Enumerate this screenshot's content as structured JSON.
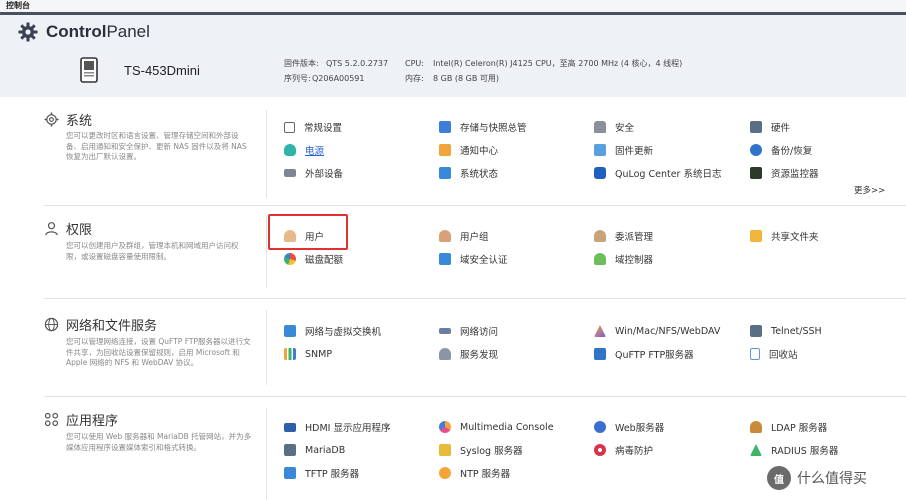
{
  "window": {
    "title": "控制台"
  },
  "header": {
    "app_title_bold": "Control",
    "app_title_rest": "Panel",
    "device_name": "TS-453Dmini",
    "firmware_label": "固件版本:",
    "firmware_value": "QTS 5.2.0.2737",
    "serial_label": "序列号:",
    "serial_value": "Q206A00591",
    "cpu_label": "CPU:",
    "cpu_value": "Intel(R) Celeron(R) J4125 CPU，至高 2700 MHz (4 核心，4 线程)",
    "memory_label": "内存:",
    "memory_value": "8 GB (8 GB 可用)"
  },
  "sections": [
    {
      "title": "系统",
      "desc": "您可以更改时区和语言设置、管理存储空间和外部设备、启用通知和安全保护、更新 NAS 固件以及将 NAS 恢复为出厂默认设置。",
      "items": [
        "常规设置",
        "存储与快照总管",
        "安全",
        "硬件",
        "电源",
        "通知中心",
        "固件更新",
        "备份/恢复",
        "外部设备",
        "系统状态",
        "QuLog Center 系统日志",
        "资源监控器"
      ],
      "more": "更多>>"
    },
    {
      "title": "权限",
      "desc": "您可以创建用户及群组，管理本机和网域用户访问权限，或设置磁盘容量使用限制。",
      "items": [
        "用户",
        "用户组",
        "委派管理",
        "共享文件夹",
        "磁盘配额",
        "域安全认证",
        "域控制器"
      ]
    },
    {
      "title": "网络和文件服务",
      "desc": "您可以管理网络连接，设置 QuFTP FTP服务器以进行文件共享，为回收站设置保留规则，启用 Microsoft 和 Apple 网络的 NFS 和 WebDAV 协议。",
      "items": [
        "网络与虚拟交换机",
        "网络访问",
        "Win/Mac/NFS/WebDAV",
        "Telnet/SSH",
        "SNMP",
        "服务发现",
        "QuFTP FTP服务器",
        "回收站"
      ]
    },
    {
      "title": "应用程序",
      "desc": "您可以使用 Web 服务器和 MariaDB 托管网站，并为多媒体应用程序设置媒体索引和格式转换。",
      "items": [
        "HDMI 显示应用程序",
        "Multimedia Console",
        "Web服务器",
        "LDAP 服务器",
        "MariaDB",
        "Syslog 服务器",
        "病毒防护",
        "RADIUS 服务器",
        "TFTP 服务器",
        "NTP 服务器"
      ]
    }
  ],
  "watermark": {
    "logo_text": "值",
    "text": "什么值得买"
  },
  "colors": {
    "accent": "#2a62c9",
    "highlight": "#e0312c",
    "header_bg": "#eef1f6"
  }
}
